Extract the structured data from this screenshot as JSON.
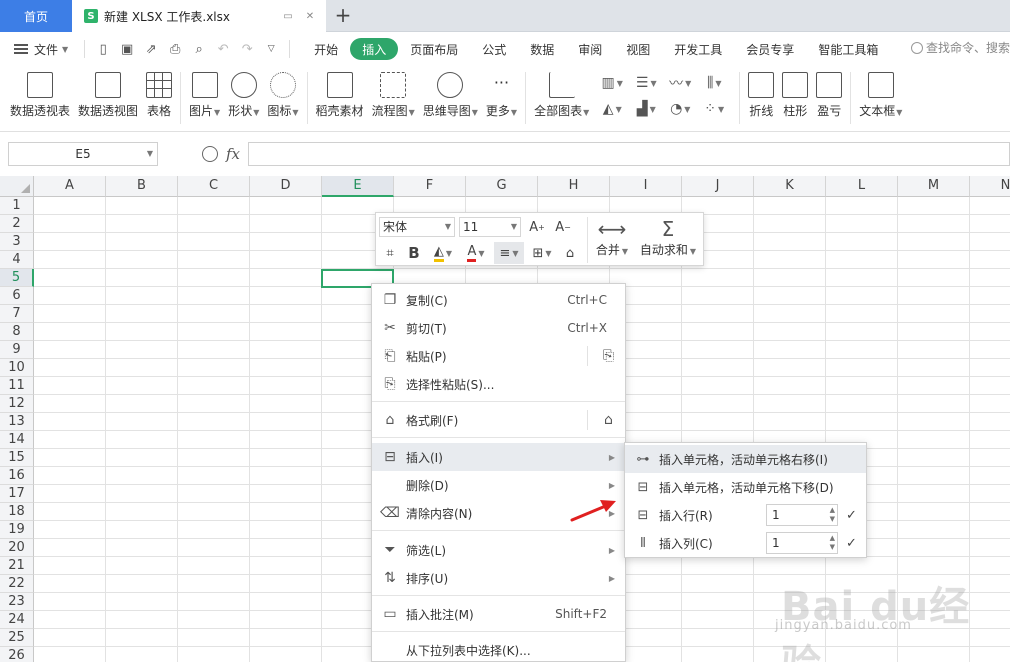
{
  "tabs": {
    "home": "首页",
    "file_icon": "S",
    "file_title": "新建 XLSX 工作表.xlsx",
    "add": "+"
  },
  "menubar": {
    "file_label": "文件",
    "tabs": [
      {
        "label": "开始",
        "active": false
      },
      {
        "label": "插入",
        "active": true
      },
      {
        "label": "页面布局",
        "active": false
      },
      {
        "label": "公式",
        "active": false
      },
      {
        "label": "数据",
        "active": false
      },
      {
        "label": "审阅",
        "active": false
      },
      {
        "label": "视图",
        "active": false
      },
      {
        "label": "开发工具",
        "active": false
      },
      {
        "label": "会员专享",
        "active": false
      },
      {
        "label": "智能工具箱",
        "active": false
      }
    ],
    "search_placeholder": "查找命令、搜索"
  },
  "ribbon": {
    "pivot_table": "数据透视表",
    "pivot_chart": "数据透视图",
    "table": "表格",
    "picture": "图片",
    "shape": "形状",
    "icon": "图标",
    "daoke": "稻壳素材",
    "flowchart": "流程图",
    "mindmap": "思维导图",
    "more": "更多",
    "all_charts": "全部图表",
    "line": "折线",
    "column": "柱形",
    "winloss": "盈亏",
    "textbox": "文本框"
  },
  "formula": {
    "namebox": "E5",
    "fx": "fx",
    "value": ""
  },
  "grid": {
    "columns": [
      "A",
      "B",
      "C",
      "D",
      "E",
      "F",
      "G",
      "H",
      "I",
      "J",
      "K",
      "L",
      "M",
      "N"
    ],
    "selected_column": "E",
    "rows": [
      "1",
      "2",
      "3",
      "4",
      "5",
      "6",
      "7",
      "8",
      "9",
      "10",
      "11",
      "12",
      "13",
      "14",
      "15",
      "16",
      "17",
      "18",
      "19",
      "20",
      "21",
      "22",
      "23",
      "24",
      "25",
      "26"
    ],
    "selected_row": "5"
  },
  "minitoolbar": {
    "font": "宋体",
    "size": "11",
    "merge": "合并",
    "autosum": "自动求和",
    "bold": "B",
    "font_color_letter": "A",
    "accent_red": "#e02020",
    "accent_yellow": "#f2c200"
  },
  "contextmenu": {
    "copy": {
      "label": "复制(C)",
      "shortcut": "Ctrl+C"
    },
    "cut": {
      "label": "剪切(T)",
      "shortcut": "Ctrl+X"
    },
    "paste": {
      "label": "粘贴(P)"
    },
    "paste_special": {
      "label": "选择性粘贴(S)..."
    },
    "format_painter": {
      "label": "格式刷(F)"
    },
    "insert": {
      "label": "插入(I)"
    },
    "delete": {
      "label": "删除(D)"
    },
    "clear": {
      "label": "清除内容(N)"
    },
    "filter": {
      "label": "筛选(L)"
    },
    "sort": {
      "label": "排序(U)"
    },
    "comment": {
      "label": "插入批注(M)",
      "shortcut": "Shift+F2"
    },
    "dropdown_pick": {
      "label": "从下拉列表中选择(K)..."
    }
  },
  "submenu": {
    "insert_right": "插入单元格，活动单元格右移(I)",
    "insert_down": "插入单元格，活动单元格下移(D)",
    "insert_row": "插入行(R)",
    "insert_row_count": "1",
    "insert_col": "插入列(C)",
    "insert_col_count": "1"
  },
  "watermark": {
    "text": "Bai du经验",
    "url": "jingyan.baidu.com"
  },
  "colors": {
    "accent_green": "#2ea66a",
    "home_tab_blue": "#3d7ee6",
    "arrow_red": "#e02020"
  }
}
